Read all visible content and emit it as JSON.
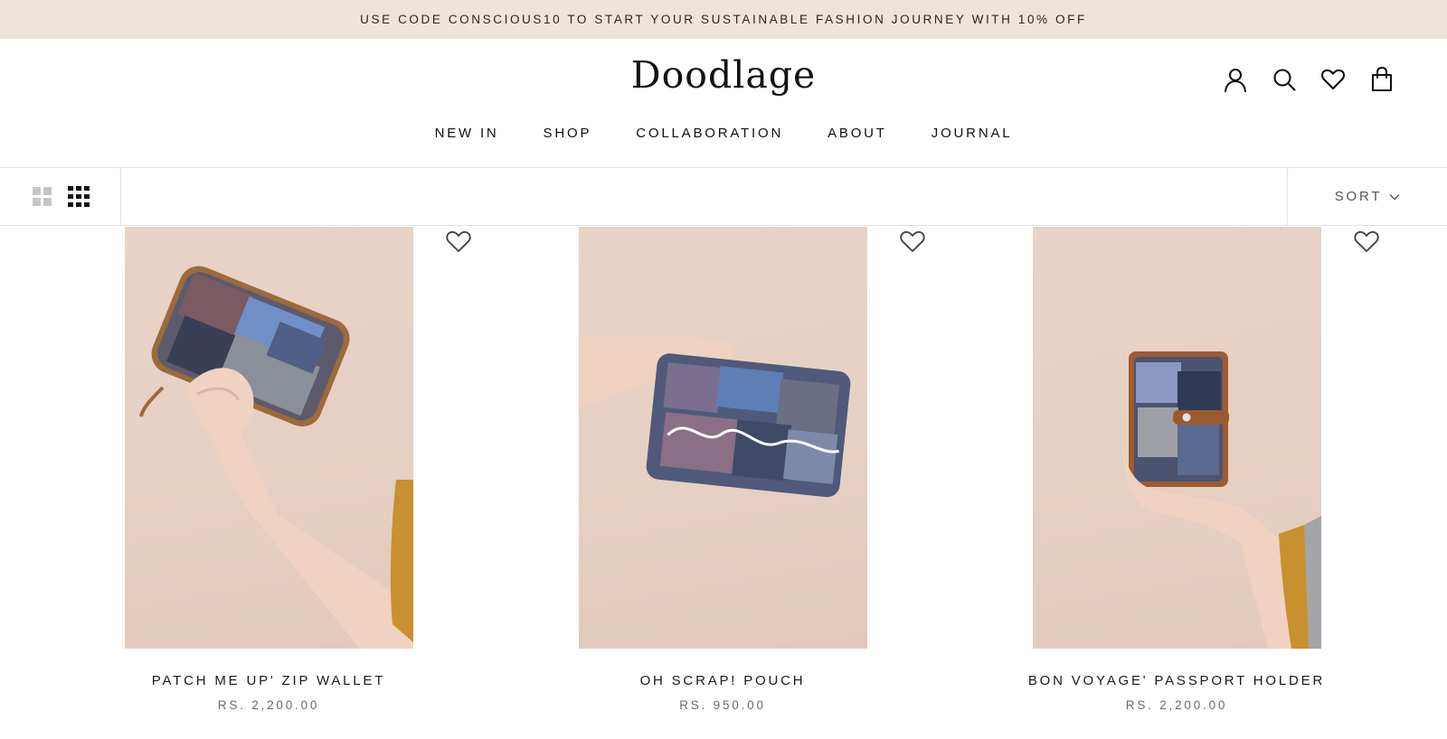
{
  "announcement": {
    "text": "USE CODE CONSCIOUS10 TO START YOUR SUSTAINABLE FASHION JOURNEY WITH 10% OFF"
  },
  "header": {
    "logo": {
      "text": "Doodlage"
    },
    "icons": [
      "account-icon",
      "search-icon",
      "heart-icon",
      "bag-icon"
    ]
  },
  "nav": {
    "items": [
      {
        "label": "NEW IN"
      },
      {
        "label": "SHOP"
      },
      {
        "label": "COLLABORATION"
      },
      {
        "label": "ABOUT"
      },
      {
        "label": "JOURNAL"
      }
    ]
  },
  "toolbar": {
    "layout_options": [
      "grid-2-icon",
      "grid-3-icon"
    ],
    "active_layout": "grid-3",
    "sort_label": "SORT"
  },
  "products": [
    {
      "title": "PATCH ME UP' ZIP WALLET",
      "price": "RS. 2,200.00"
    },
    {
      "title": "OH SCRAP! POUCH",
      "price": "RS. 950.00"
    },
    {
      "title": "BON VOYAGE' PASSPORT HOLDER",
      "price": "RS. 2,200.00"
    }
  ],
  "colors": {
    "announcement_bg": "#efe4d9",
    "product_bg": "#e7d1c4",
    "text": "#1c1b1b",
    "muted": "#6a6a6a",
    "border": "#e1e1e1"
  }
}
